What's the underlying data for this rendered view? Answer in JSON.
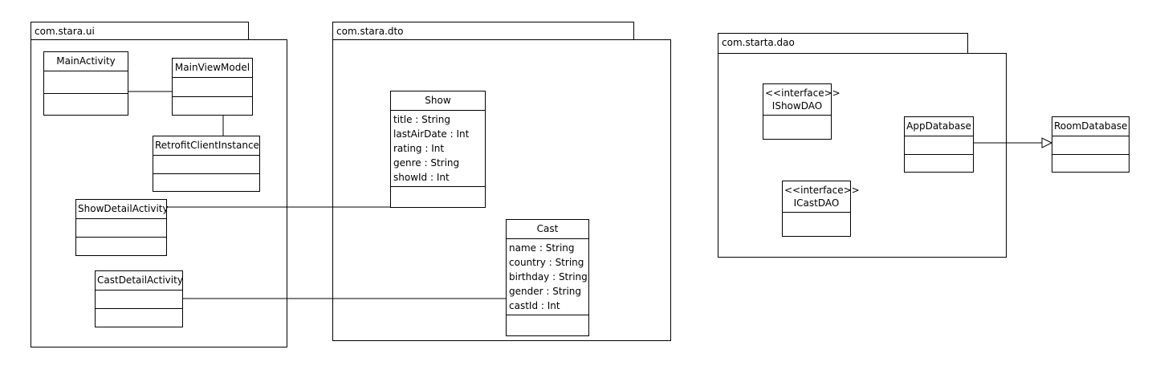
{
  "packages": {
    "ui": {
      "name": "com.stara.ui"
    },
    "dto": {
      "name": "com.stara.dto"
    },
    "dao": {
      "name": "com.starta.dao"
    }
  },
  "classes": {
    "main_activity": {
      "name": "MainActivity"
    },
    "main_view_model": {
      "name": "MainViewModel"
    },
    "retrofit_client_instance": {
      "name": "RetrofitClientInstance"
    },
    "show_detail_activity": {
      "name": "ShowDetailActivity"
    },
    "cast_detail_activity": {
      "name": "CastDetailActivity"
    },
    "show": {
      "name": "Show",
      "attributes": [
        "title : String",
        "lastAirDate : Int",
        "rating : Int",
        "genre : String",
        "showId : Int"
      ]
    },
    "cast": {
      "name": "Cast",
      "attributes": [
        "name : String",
        "country : String",
        "birthday : String",
        "gender : String",
        "castId : Int"
      ]
    },
    "ishow_dao": {
      "stereotype": "<<interface>>",
      "name": "IShowDAO"
    },
    "icast_dao": {
      "stereotype": "<<interface>>",
      "name": "ICastDAO"
    },
    "app_database": {
      "name": "AppDatabase"
    },
    "room_database": {
      "name": "RoomDatabase"
    }
  },
  "relations": [
    {
      "from": "MainActivity",
      "to": "MainViewModel",
      "kind": "association"
    },
    {
      "from": "MainViewModel",
      "to": "RetrofitClientInstance",
      "kind": "association"
    },
    {
      "from": "ShowDetailActivity",
      "to": "Show",
      "kind": "association"
    },
    {
      "from": "CastDetailActivity",
      "to": "Cast",
      "kind": "association"
    },
    {
      "from": "AppDatabase",
      "to": "RoomDatabase",
      "kind": "generalization"
    }
  ]
}
